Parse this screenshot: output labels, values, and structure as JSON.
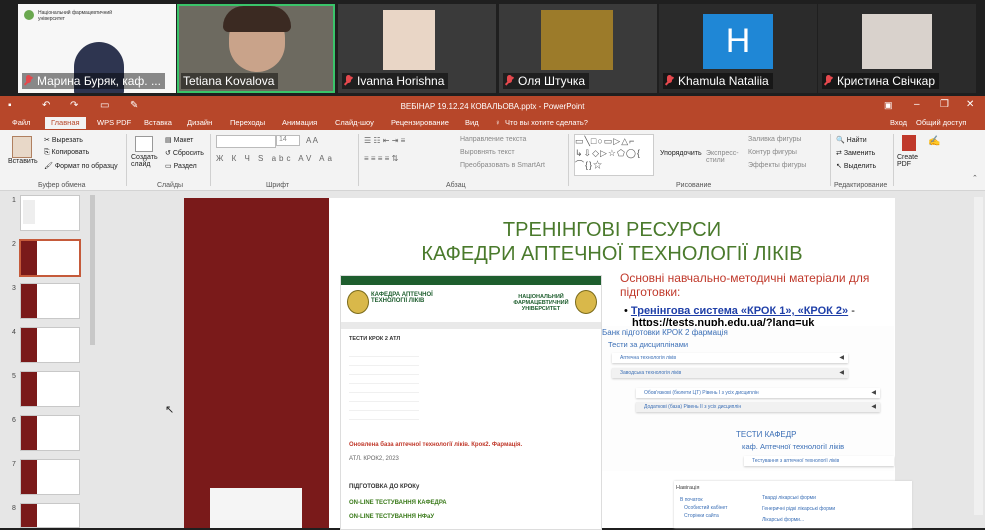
{
  "participants": [
    {
      "name": "Марина Буряк, каф. ...",
      "muted": true
    },
    {
      "name": "Tetiana Kovalova",
      "muted": false,
      "active": true
    },
    {
      "name": "Ivanna Horishna",
      "muted": true
    },
    {
      "name": "Оля Штучка",
      "muted": true
    },
    {
      "name": "Khamula Nataliia",
      "muted": true,
      "avatar_letter": "H"
    },
    {
      "name": "Кристина Свічкар",
      "muted": true
    }
  ],
  "tile1_caption": "Національний фармацевтичний університет",
  "ppt": {
    "title": "ВЕБІНАР 19.12.24 КОВАЛЬОВА.pptx - PowerPoint",
    "tabs": [
      "Файл",
      "Главная",
      "WPS PDF",
      "Вставка",
      "Дизайн",
      "Переходы",
      "Анимация",
      "Слайд-шоу",
      "Рецензирование",
      "Вид"
    ],
    "tell_me": "Что вы хотите сделать?",
    "signin": "Вход",
    "share": "Общий доступ",
    "ribbon": {
      "paste": "Вставить",
      "cut": "Вырезать",
      "copy": "Копировать",
      "format_painter": "Формат по образцу",
      "clipboard_group": "Буфер обмена",
      "new_slide": "Создать слайд",
      "layout": "Макет",
      "reset": "Сбросить",
      "section": "Раздел",
      "slides_group": "Слайды",
      "font_size": "14",
      "font_group": "Шрифт",
      "text_direction": "Направление текста",
      "align_text": "Выровнять текст",
      "smartart": "Преобразовать в SmartArt",
      "paragraph_group": "Абзац",
      "arrange": "Упорядочить",
      "quick_styles": "Экспресс-стили",
      "shape_fill": "Заливка фигуры",
      "shape_outline": "Контур фигуры",
      "shape_effects": "Эффекты фигуры",
      "drawing_group": "Рисование",
      "find": "Найти",
      "replace": "Заменить",
      "select": "Выделить",
      "editing_group": "Редактирование",
      "create_pdf": "Create PDF"
    },
    "slide_numbers": [
      "1",
      "2",
      "3",
      "4",
      "5",
      "6",
      "7",
      "8"
    ],
    "selected_slide": 2
  },
  "slide": {
    "title_line1": "ТРЕНІНГОВІ РЕСУРСИ",
    "title_line2": "КАФЕДРИ АПТЕЧНОЇ ТЕХНОЛОГІЇ ЛІКІВ",
    "materials_heading": "Основні навчально-методичні матеріали для підготовки:",
    "link_text": "Тренінгова система «КРОК 1», «КРОК 2»",
    "link_dash": " -",
    "url": "https://tests.nuph.edu.ua/?lang=uk",
    "site": {
      "dept_name": "КАФЕДРА АПТЕЧНОЇ ТЕХНОЛОГІЇ ЛІКІВ",
      "univ_name": "НАЦІОНАЛЬНИЙ ФАРМАЦЕВТИЧНИЙ УНІВЕРСИТЕТ",
      "tests_heading": "ТЕСТИ КРОК 2 АТЛ",
      "updated_base": "Оновлена база аптечної технології ліків. Крок2. Фармація.",
      "atl_year": "АТЛ. КРОК2, 2023",
      "prep": "ПІДГОТОВКА ДО КРОКу",
      "online1": "ON-LINE ТЕСТУВАННЯ КАФЕДРА",
      "online2": "ON-LINE ТЕСТУВАННЯ НФаУ"
    },
    "moodle": {
      "bank": "Банк підготовки КРОК 2 фармація",
      "by_discipline": "Тести за дисциплінами",
      "item1": "Аптечна технологія ліків",
      "item2": "Заводська технологія ліків",
      "item3": "Обов'язкові (бюлети ЦТ) Рівень І з усіх дисциплін",
      "item4": "Додаткові (база) Рівень ІІ з усіх дисциплін",
      "dept_tests": "ТЕСТИ КАФЕДР",
      "dept_sub": "каф. Аптечної технології ліків",
      "dept_item": "Тестування з аптечної технології ліків"
    },
    "nav_box": {
      "heading": "Навігація",
      "home": "В початок",
      "dashboard": "Особистий кабінет",
      "pages": "Сторінки сайта",
      "items": [
        "Тварді лікарські форми",
        "Генеричні рідкі лікарські форми",
        "Лікарські форми..."
      ]
    }
  },
  "colors": {
    "ppt_accent": "#b7472a",
    "slide_title": "#4a7a2c",
    "slide_sidebar": "#7a1a1a",
    "heading_red": "#c0392b",
    "link_blue": "#1f3fa8"
  }
}
